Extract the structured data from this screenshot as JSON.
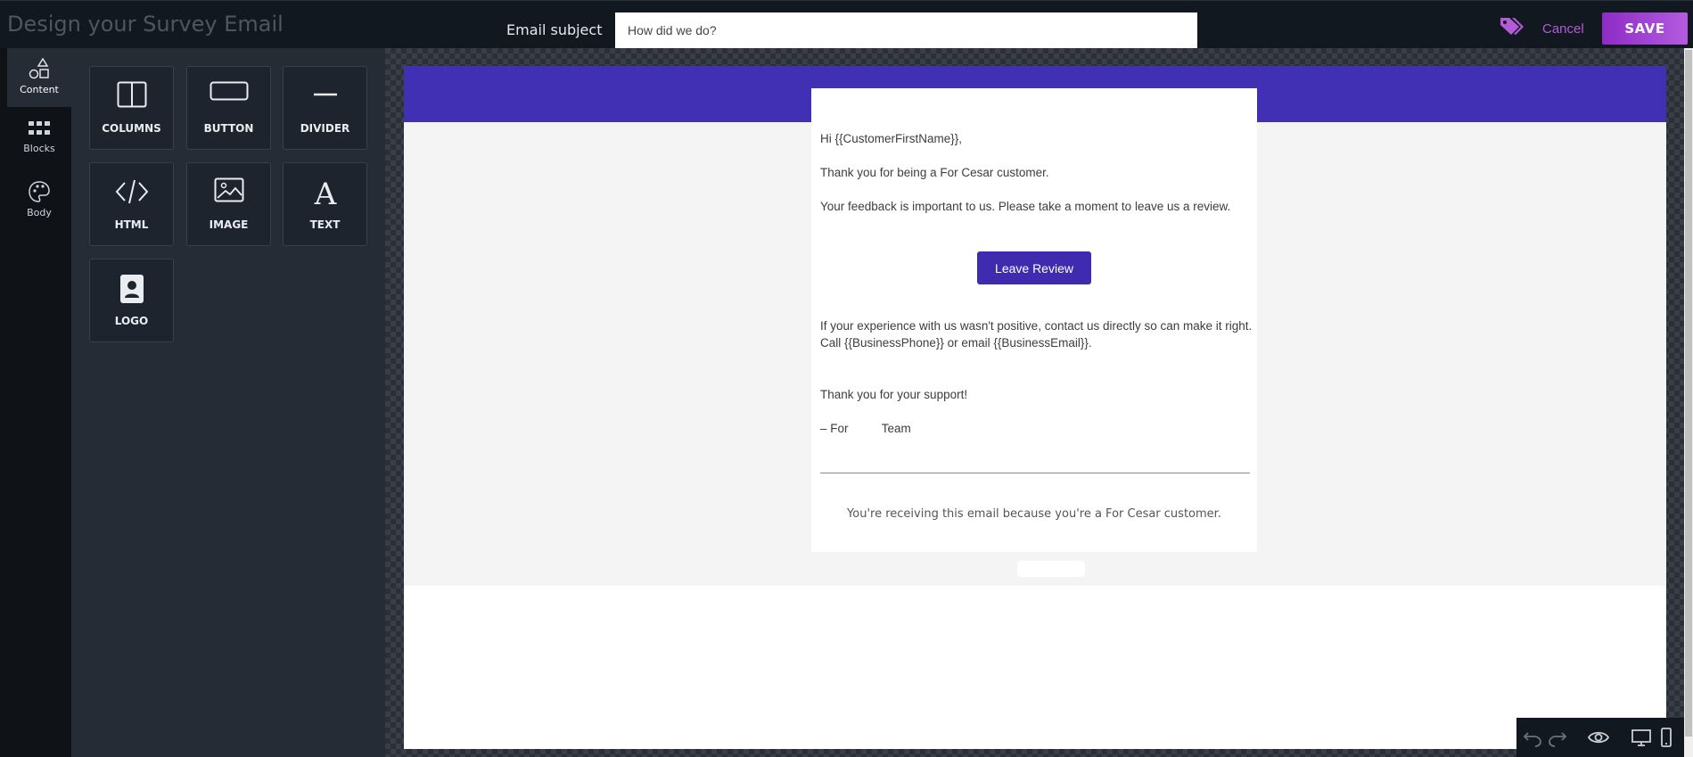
{
  "header": {
    "title": "Design your Survey Email",
    "subject_label": "Email subject",
    "subject_value": "How did we do?",
    "cancel_label": "Cancel",
    "save_label": "SAVE",
    "accent_color": "#b45bd6"
  },
  "sidebar": {
    "items": [
      {
        "label": "Content",
        "icon": "shapes-icon",
        "active": true
      },
      {
        "label": "Blocks",
        "icon": "grid-icon",
        "active": false
      },
      {
        "label": "Body",
        "icon": "palette-icon",
        "active": false
      }
    ]
  },
  "tools": [
    {
      "label": "COLUMNS",
      "icon": "columns-icon"
    },
    {
      "label": "BUTTON",
      "icon": "button-icon"
    },
    {
      "label": "DIVIDER",
      "icon": "divider-icon"
    },
    {
      "label": "HTML",
      "icon": "code-icon"
    },
    {
      "label": "IMAGE",
      "icon": "image-icon"
    },
    {
      "label": "TEXT",
      "icon": "text-icon"
    },
    {
      "label": "LOGO",
      "icon": "contact-card-icon"
    }
  ],
  "email": {
    "greeting": "Hi {{CustomerFirstName}},",
    "thanks": "Thank you for being a For Cesar customer.",
    "feedback": "Your feedback is important to us. Please take a moment to leave us a review.",
    "button_label": "Leave Review",
    "negative": "If your experience with us wasn't positive, contact us directly so can make it right. Call {{BusinessPhone}} or email {{BusinessEmail}}.",
    "support": "Thank you for your support!",
    "signoff": "– For          Team",
    "footer": "You're receiving this email because you're a For Cesar customer.",
    "brand_color": "#4130b4"
  },
  "bottom_toolbar": [
    "undo-icon",
    "redo-icon",
    "preview-eye-icon",
    "desktop-icon",
    "mobile-icon"
  ]
}
